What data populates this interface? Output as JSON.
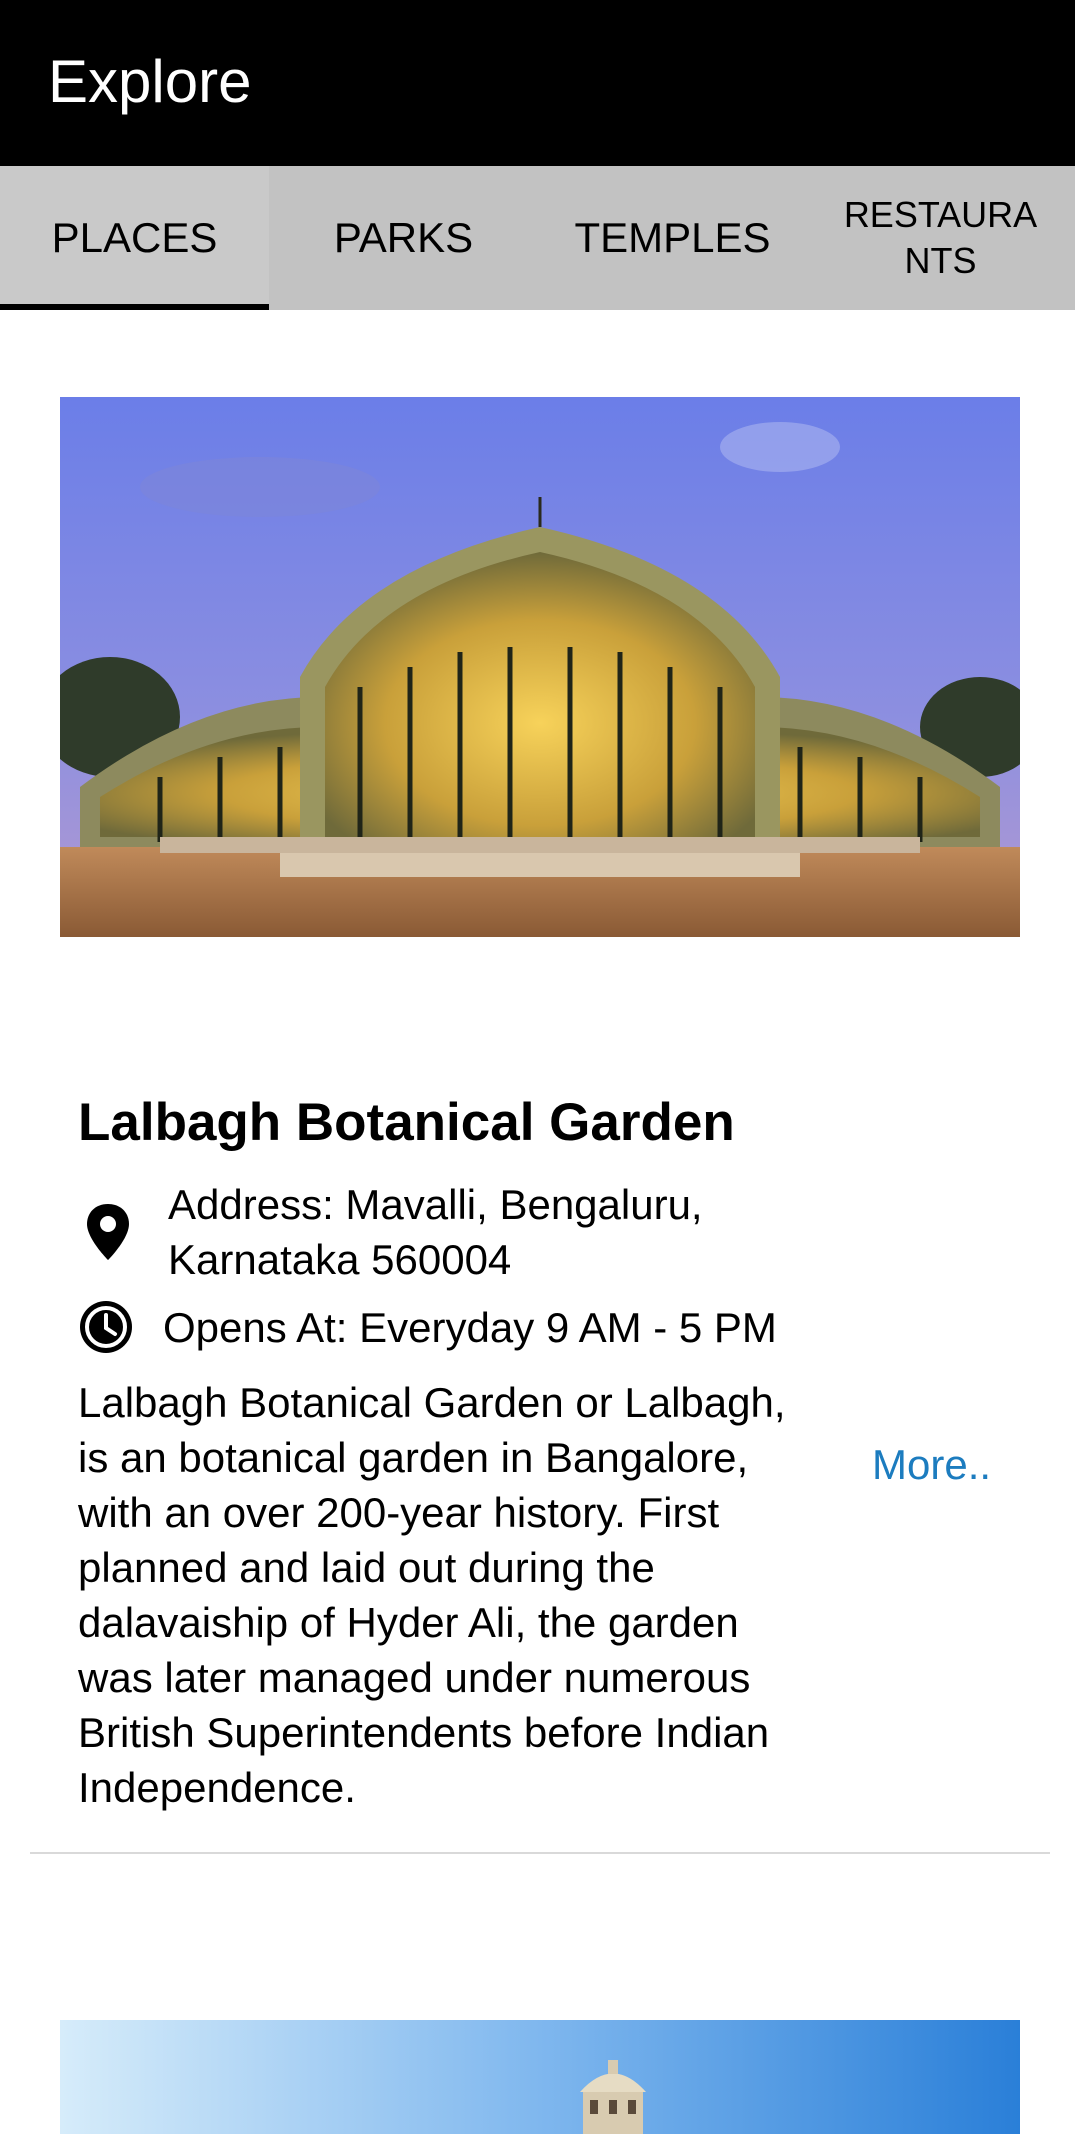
{
  "appbar": {
    "title": "Explore"
  },
  "tabs": [
    {
      "label": "PLACES",
      "active": true
    },
    {
      "label": "PARKS",
      "active": false
    },
    {
      "label": "TEMPLES",
      "active": false
    },
    {
      "label": "RESTAURA NTS",
      "active": false
    }
  ],
  "card": {
    "image_icon": "glasshouse-photo",
    "title": "Lalbagh Botanical Garden",
    "address": "Address: Mavalli, Bengaluru, Karnataka 560004",
    "hours": "Opens At: Everyday 9 AM - 5 PM",
    "description": "Lalbagh Botanical Garden or Lalbagh, is an botanical garden in Bangalore, with an over 200-year history. First planned and laid out during the dalavaiship of Hyder Ali, the garden was later managed under numerous British Superintendents before Indian Independence.",
    "more_label": "More.."
  },
  "next_card": {
    "image_icon": "palace-tower-photo"
  },
  "colors": {
    "appbar": "#000000",
    "tabbar": "#c2c2c2",
    "link": "#1c7cbf",
    "divider": "#d9d9d9"
  }
}
